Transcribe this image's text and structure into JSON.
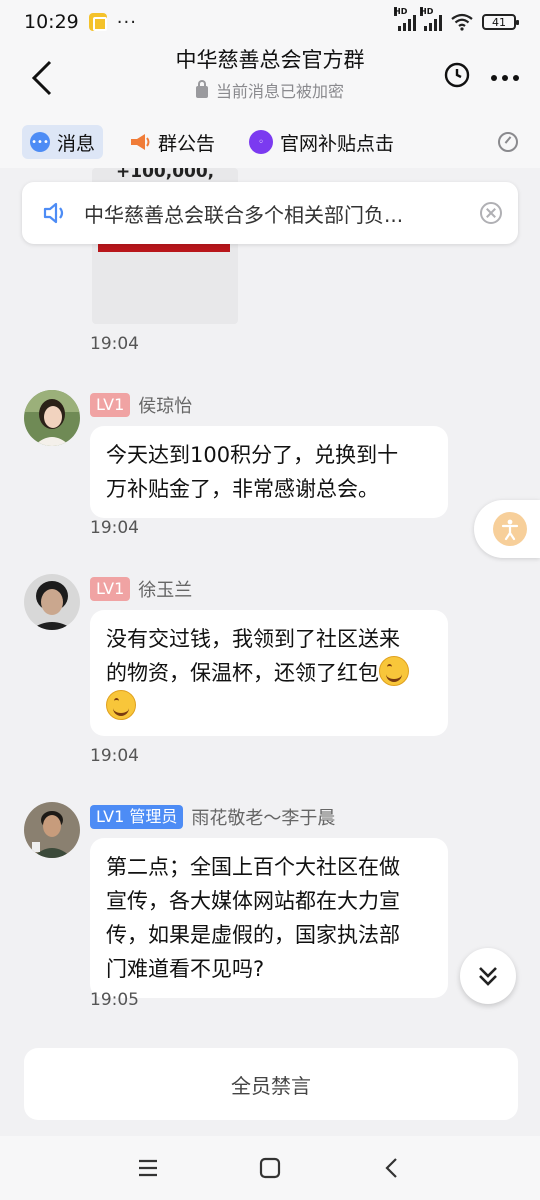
{
  "status_bar": {
    "time": "10:29",
    "dots": "···",
    "signal_label": "HD",
    "battery": "41"
  },
  "header": {
    "title": "中华慈善总会官方群",
    "subtitle": "当前消息已被加密"
  },
  "tabs": [
    {
      "label": "消息",
      "icon": "chat-bubble-icon"
    },
    {
      "label": "群公告",
      "icon": "megaphone-icon"
    },
    {
      "label": "官网补贴点击",
      "icon": "purple-avatar-icon"
    }
  ],
  "preview_card": {
    "amount": "+100,000,"
  },
  "announcement": {
    "text": "中华慈善总会联合多个相关部门负..."
  },
  "messages": [
    {
      "time": "19:04"
    },
    {
      "level": "LV1",
      "name": "侯琼怡",
      "text_lines": [
        "今天达到100积分了，兑换到十",
        "万补贴金了，非常感谢总会。"
      ],
      "time": "19:04"
    },
    {
      "level": "LV1",
      "name": "徐玉兰",
      "text_lines": [
        "没有交过钱，我领到了社区送来",
        "的物资，保温杯，还领了红包"
      ],
      "time": "19:04"
    },
    {
      "level": "LV1 管理员",
      "name": "雨花敬老～李于晨",
      "text_lines": [
        "第二点；全国上百个大社区在做",
        "宣传，各大媒体网站都在大力宣",
        "传，如果是虚假的，国家执法部",
        "门难道看不见吗?"
      ],
      "time": "19:05"
    }
  ],
  "mute_label": "全员禁言",
  "colors": {
    "accent": "#4d8cf5",
    "level_badge": "#f0a3a3",
    "admin_badge": "#4d8cf5",
    "background": "#f1f1f3"
  }
}
